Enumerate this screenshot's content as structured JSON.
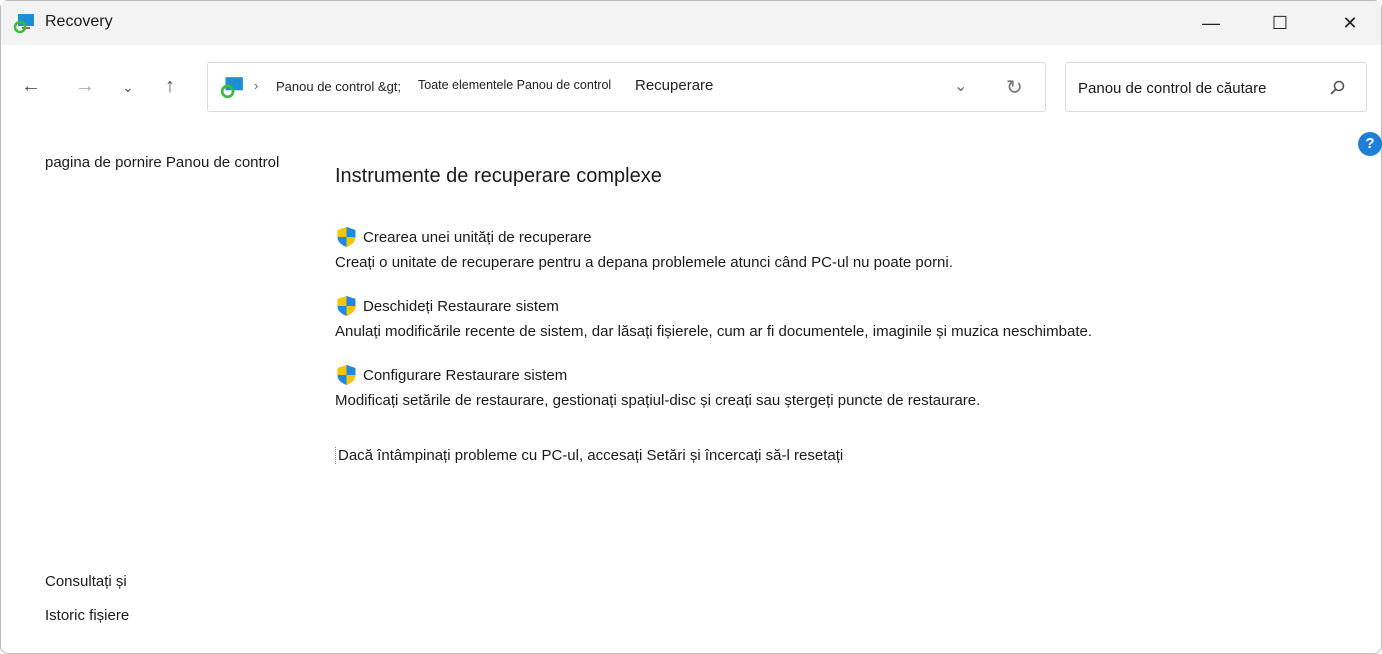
{
  "window": {
    "title": "Recovery",
    "icon": "recovery-icon"
  },
  "controls": {
    "minimize": "—",
    "maximize": "☐",
    "close": "✕"
  },
  "address": {
    "crumbs": [
      "Panou de control &gt;",
      "Toate elementele Panou de control",
      "Recuperare"
    ]
  },
  "search": {
    "placeholder": "Panou de control de căutare"
  },
  "sidebar": {
    "home": "pagina de pornire Panou de control",
    "see_also": "Consultați și",
    "file_history": "Istoric fișiere"
  },
  "main": {
    "heading": "Instrumente de recuperare complexe",
    "items": [
      {
        "label": "Crearea unei unități de recuperare",
        "desc": "Creați o unitate de recuperare pentru a depana problemele atunci când PC-ul nu poate porni."
      },
      {
        "label": "Deschideți Restaurare sistem",
        "desc": "Anulați modificările recente de sistem, dar lăsați fișierele, cum ar fi documentele, imaginile și muzica neschimbate."
      },
      {
        "label": "Configurare Restaurare sistem",
        "desc": "Modificați setările de restaurare, gestionați spațiul-disc și creați sau ștergeți puncte de restaurare."
      }
    ],
    "reset_link": "Dacă întâmpinați probleme cu PC-ul, accesați Setări și încercați să-l resetați"
  },
  "help": "?"
}
